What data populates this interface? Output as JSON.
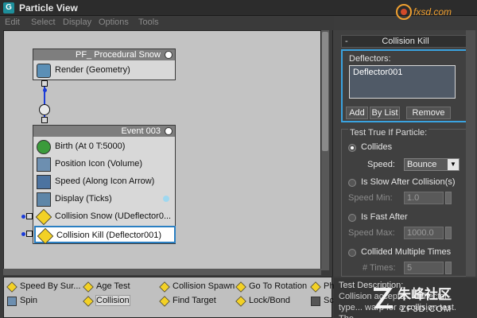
{
  "window": {
    "title": "Particle View",
    "app_icon_glyph": "G"
  },
  "watermark": {
    "text": "fxsd.com"
  },
  "menubar": [
    "Edit",
    "Select",
    "Display",
    "Options",
    "Tools"
  ],
  "graph": {
    "source_node": {
      "title": "PF_ Procedural Snow",
      "operator": "Render (Geometry)"
    },
    "event_node": {
      "title": "Event 003",
      "operators": [
        {
          "label": "Birth  (At 0 T:5000)",
          "icon": "birth-icon"
        },
        {
          "label": "Position Icon (Volume)",
          "icon": "position-icon"
        },
        {
          "label": "Speed  (Along Icon Arrow)",
          "icon": "speed-icon"
        },
        {
          "label": "Display  (Ticks)",
          "icon": "display-icon"
        },
        {
          "label": "Collision Snow (UDeflector0...",
          "icon": "collision-icon"
        },
        {
          "label": "Collision Kill (Deflector001)",
          "icon": "collision-icon",
          "selected": true
        }
      ]
    }
  },
  "palette": [
    {
      "label": "Speed By Sur...",
      "icon": "speed-surface-icon"
    },
    {
      "label": "Age Test",
      "icon": "test-icon"
    },
    {
      "label": "Collision Spawn",
      "icon": "test-icon"
    },
    {
      "label": "Go To Rotation",
      "icon": "test-icon"
    },
    {
      "label": "Ph",
      "icon": "test-icon"
    },
    {
      "label": "Spin",
      "icon": "spin-icon"
    },
    {
      "label": "Collision",
      "icon": "test-icon",
      "selected": true
    },
    {
      "label": "Find Target",
      "icon": "test-icon"
    },
    {
      "label": "Lock/Bond",
      "icon": "test-icon"
    },
    {
      "label": "Sc",
      "icon": "script-icon"
    }
  ],
  "panel": {
    "rollout_title": "Collision Kill",
    "rollout_toggle": "-",
    "deflectors_label": "Deflectors:",
    "deflectors": [
      "Deflector001"
    ],
    "buttons": {
      "add": "Add",
      "by_list": "By List",
      "remove": "Remove"
    },
    "test_group_label": "Test True If Particle:",
    "collides_label": "Collides",
    "speed_label": "Speed:",
    "speed_value": "Bounce",
    "slow_label": "Is Slow After Collision(s)",
    "speed_min_label": "Speed Min:",
    "speed_min_value": "1.0",
    "fast_label": "Is Fast After",
    "speed_max_label": "Speed Max:",
    "speed_max_value": "1000.0",
    "multiple_label": "Collided Multiple Times",
    "times_label": "# Times:",
    "times_value": "5",
    "selected_option": "Collides"
  },
  "description": {
    "header": "Test Description:",
    "body": "Collision accepts... deflector-type... warp for a collision test. The"
  },
  "footer_watermark": {
    "cn": "朱峰社区",
    "en": "ZF3D.COM"
  }
}
